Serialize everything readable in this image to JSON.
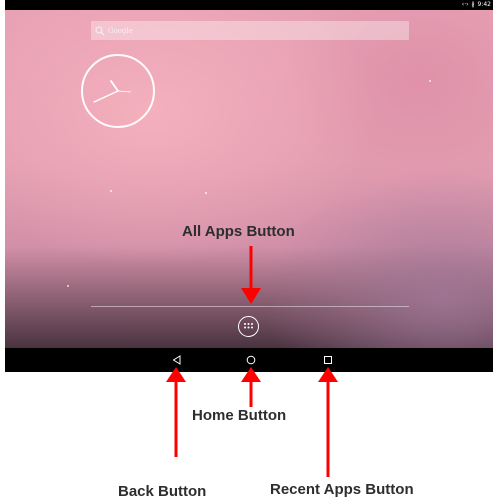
{
  "status_bar": {
    "time": "9:42",
    "icons": [
      "wifi-icon",
      "bluetooth-icon"
    ]
  },
  "home_screen": {
    "search": {
      "text": "Google"
    },
    "clock": {
      "type": "analog"
    }
  },
  "navigation_bar": {
    "buttons": [
      "back",
      "home",
      "recent-apps"
    ]
  },
  "annotations": {
    "all_apps": "All Apps Button",
    "home": "Home Button",
    "back": "Back Button",
    "recent": "Recent Apps Button"
  },
  "colors": {
    "arrow": "#ff0000",
    "label": "#2e2e2e",
    "navbar": "#000000"
  }
}
